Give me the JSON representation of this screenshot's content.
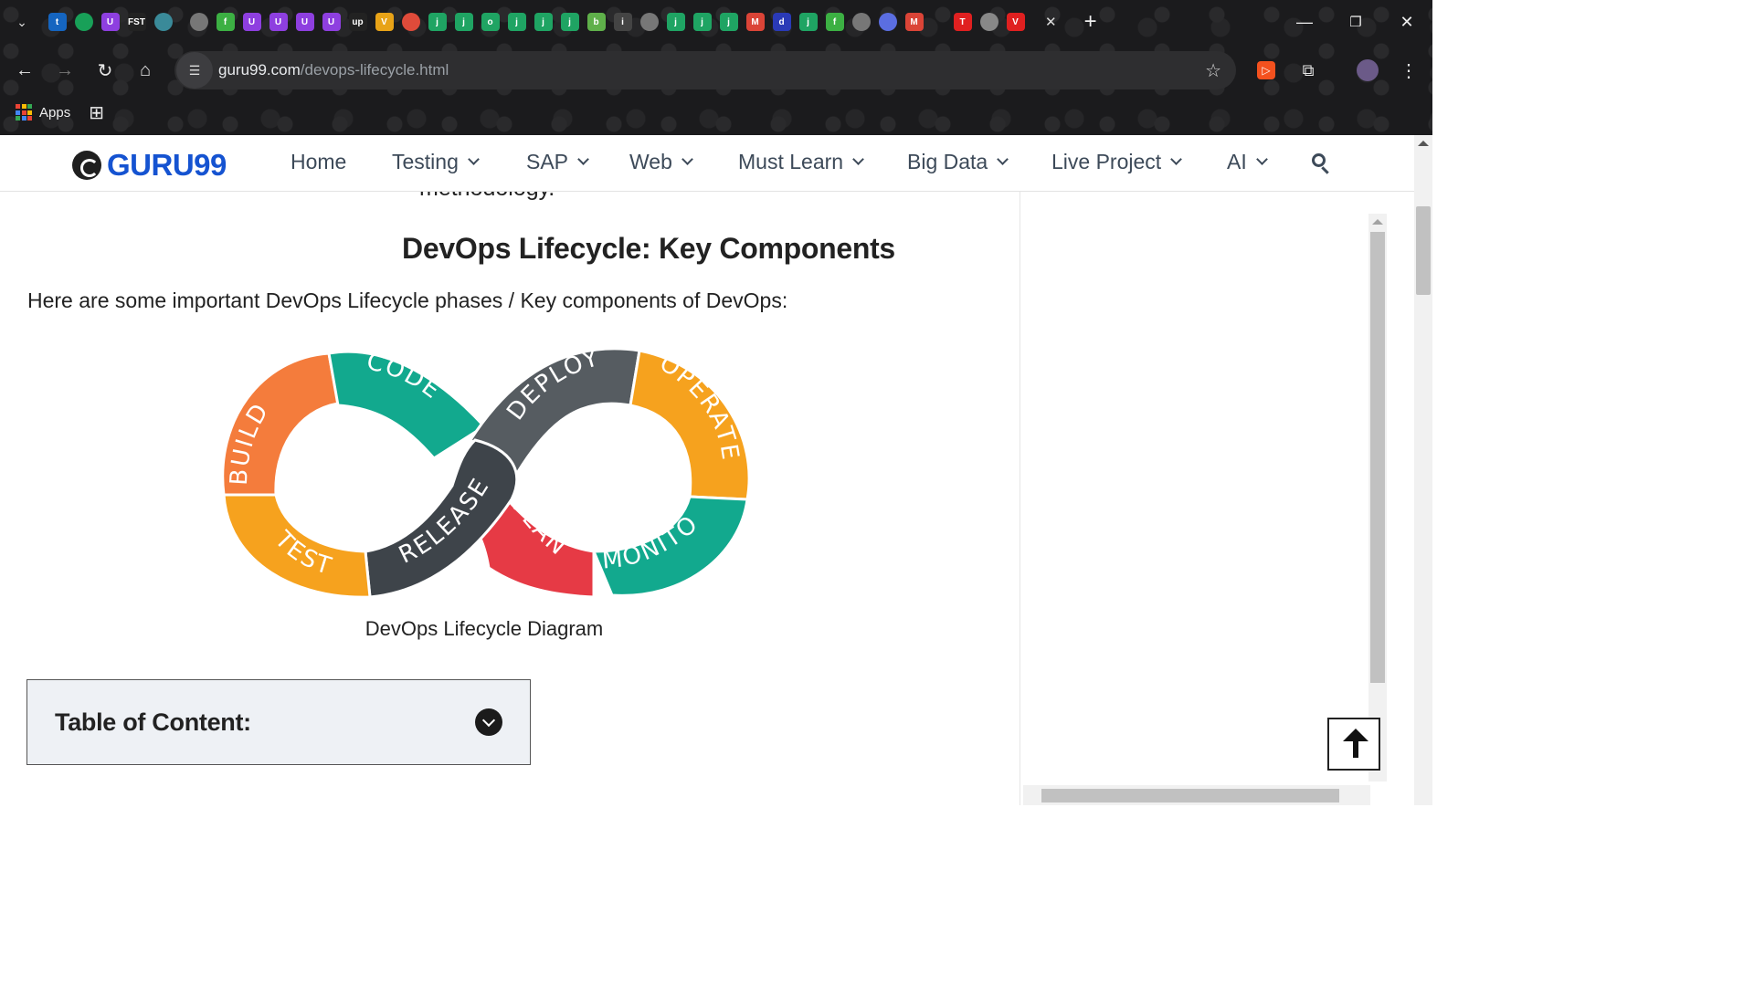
{
  "browser": {
    "url_domain": "guru99.com",
    "url_path": "/devops-lifecycle.html",
    "bookmark_apps_label": "Apps",
    "favicons": [
      {
        "name": "t-icon",
        "text": "t",
        "color": "#1565c0"
      },
      {
        "name": "green-icon",
        "text": "",
        "color": "#18a058"
      },
      {
        "name": "u-icon",
        "text": "U",
        "color": "#8e3fe0"
      },
      {
        "name": "fst-icon",
        "text": "FST",
        "color": "#222222"
      },
      {
        "name": "globe-icon",
        "text": "",
        "color": "#3a8a99"
      }
    ],
    "favicons2": [
      {
        "text": "",
        "color": "#777777"
      },
      {
        "text": "f",
        "color": "#3cb043"
      },
      {
        "text": "U",
        "color": "#8e3fe0"
      },
      {
        "text": "U",
        "color": "#8e3fe0"
      },
      {
        "text": "U",
        "color": "#8e3fe0"
      },
      {
        "text": "U",
        "color": "#8e3fe0"
      },
      {
        "text": "up",
        "color": "#222222"
      },
      {
        "text": "V",
        "color": "#e8a317"
      },
      {
        "text": "",
        "color": "#e04b3a"
      },
      {
        "text": "j",
        "color": "#1fa463"
      },
      {
        "text": "j",
        "color": "#1fa463"
      },
      {
        "text": "o",
        "color": "#1fa463"
      },
      {
        "text": "j",
        "color": "#1fa463"
      },
      {
        "text": "j",
        "color": "#1fa463"
      },
      {
        "text": "j",
        "color": "#1fa463"
      },
      {
        "text": "b",
        "color": "#5fb04a"
      },
      {
        "text": "i",
        "color": "#444444"
      },
      {
        "text": "",
        "color": "#777777"
      },
      {
        "text": "j",
        "color": "#1fa463"
      },
      {
        "text": "j",
        "color": "#1fa463"
      },
      {
        "text": "j",
        "color": "#1fa463"
      },
      {
        "text": "M",
        "color": "#db4437"
      },
      {
        "text": "d",
        "color": "#2a3ab7"
      },
      {
        "text": "j",
        "color": "#1fa463"
      },
      {
        "text": "f",
        "color": "#3cb043"
      },
      {
        "text": "",
        "color": "#777777"
      },
      {
        "text": "",
        "color": "#5b6ee1"
      },
      {
        "text": "M",
        "color": "#db4437"
      }
    ],
    "favicons3": [
      {
        "text": "T",
        "color": "#e02020"
      },
      {
        "text": "",
        "color": "#888888"
      },
      {
        "text": "V",
        "color": "#e02020"
      }
    ],
    "tab_close_glyph": "✕",
    "new_tab_glyph": "+"
  },
  "site": {
    "logo_text": "GURU99",
    "nav": [
      {
        "label": "Home",
        "dropdown": false
      },
      {
        "label": "Testing",
        "dropdown": true
      },
      {
        "label": "SAP",
        "dropdown": true
      },
      {
        "label": "Web",
        "dropdown": true
      },
      {
        "label": "Must Learn",
        "dropdown": true
      },
      {
        "label": "Big Data",
        "dropdown": true
      },
      {
        "label": "Live Project",
        "dropdown": true
      },
      {
        "label": "AI",
        "dropdown": true
      }
    ]
  },
  "article": {
    "previous_line_fragment": "methodology.",
    "heading": "DevOps Lifecycle: Key Components",
    "intro": "Here are some important DevOps Lifecycle phases / Key components of DevOps:",
    "diagram_segments": [
      {
        "label": "BUILD",
        "color": "#f47c3c"
      },
      {
        "label": "CODE",
        "color": "#12a98e"
      },
      {
        "label": "DEPLOY",
        "color": "#565c61"
      },
      {
        "label": "OPERATE",
        "color": "#f6a21e"
      },
      {
        "label": "MONITOR",
        "color": "#12a98e"
      },
      {
        "label": "PLAN",
        "color": "#e63a45"
      },
      {
        "label": "RELEASE",
        "color": "#3e444a"
      },
      {
        "label": "TEST",
        "color": "#f6a21e"
      }
    ],
    "caption": "DevOps Lifecycle Diagram",
    "toc_title": "Table of Content:"
  }
}
